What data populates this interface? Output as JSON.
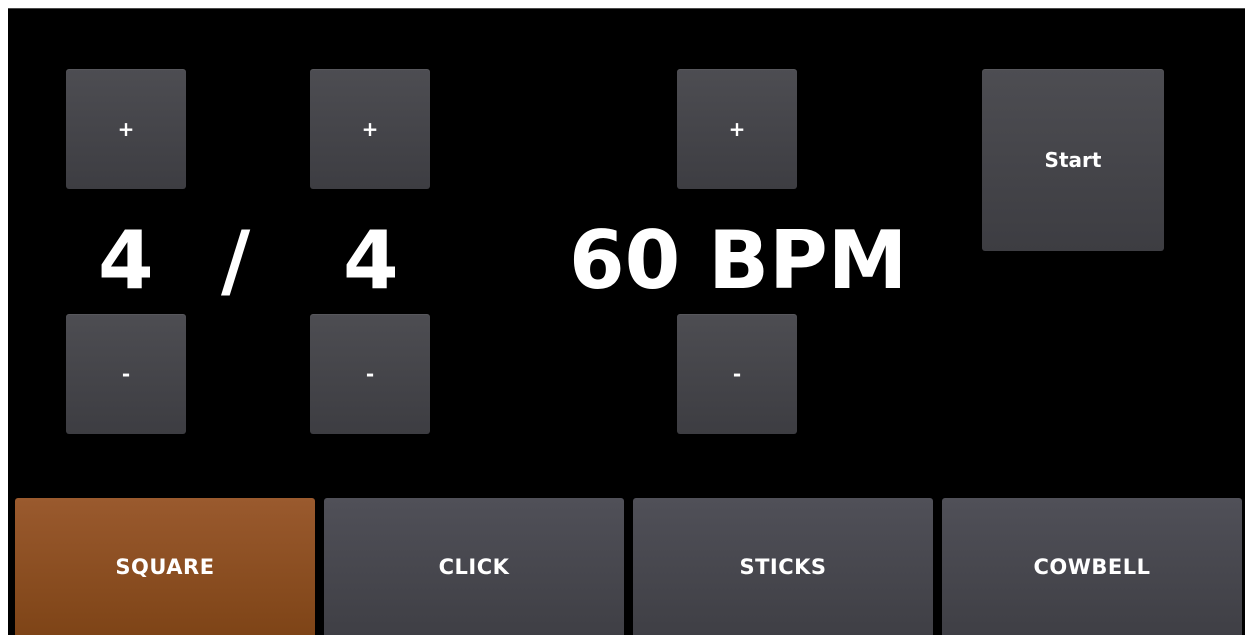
{
  "time_signature": {
    "beats": "4",
    "separator": "/",
    "note_value": "4",
    "beats_increment_label": "+",
    "beats_decrement_label": "-",
    "note_increment_label": "+",
    "note_decrement_label": "-"
  },
  "tempo": {
    "display": "60 BPM",
    "increment_label": "+",
    "decrement_label": "-"
  },
  "start_label": "Start",
  "sounds": [
    {
      "label": "SQUARE",
      "selected": true
    },
    {
      "label": "CLICK",
      "selected": false
    },
    {
      "label": "STICKS",
      "selected": false
    },
    {
      "label": "COWBELL",
      "selected": false
    }
  ],
  "colors": {
    "background": "#000000",
    "button": "#45454a",
    "selected_sound": "#8a4d22",
    "text": "#ffffff"
  }
}
